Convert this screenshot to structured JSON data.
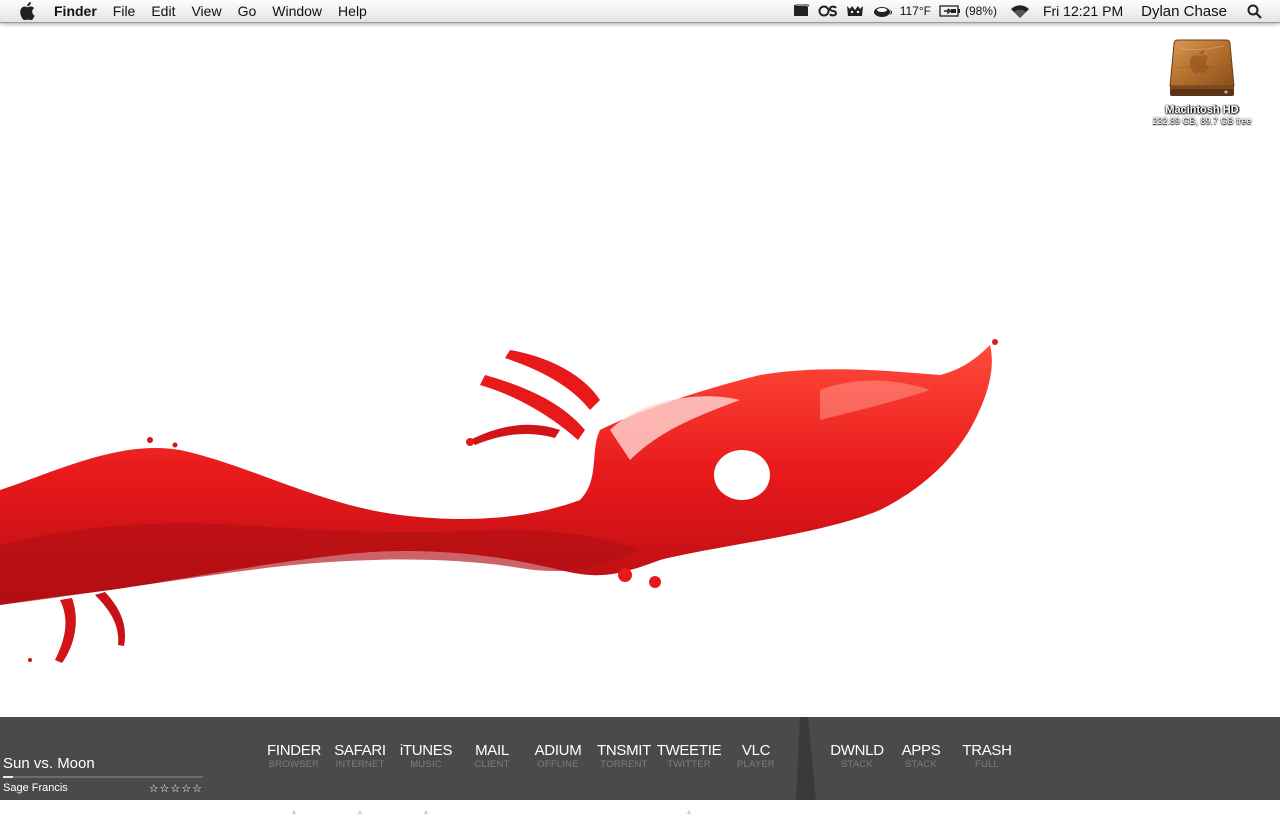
{
  "menubar": {
    "apple_icon": "apple-logo-icon",
    "app_name": "Finder",
    "items": [
      "File",
      "Edit",
      "View",
      "Go",
      "Window",
      "Help"
    ],
    "status": {
      "temperature": "117°F",
      "battery_percent": "(98%)",
      "clock": "Fri 12:21 PM",
      "user": "Dylan Chase"
    }
  },
  "desktop": {
    "drive_name": "Macintosh HD",
    "drive_info": "232.89 GB, 89.7 GB free"
  },
  "dock": {
    "now_playing": {
      "song": "Sun vs. Moon",
      "artist": "Sage Francis",
      "rating_stars": "☆☆☆☆☆",
      "progress": 0.05
    },
    "apps": [
      {
        "title": "FINDER",
        "sub": "BROWSER",
        "running": true
      },
      {
        "title": "SAFARI",
        "sub": "INTERNET",
        "running": true
      },
      {
        "title": "iTUNES",
        "sub": "MUSIC",
        "running": true
      },
      {
        "title": "MAIL",
        "sub": "CLIENT",
        "running": false
      },
      {
        "title": "ADIUM",
        "sub": "OFFLINE",
        "running": false
      },
      {
        "title": "TNSMIT",
        "sub": "TORRENT",
        "running": false
      },
      {
        "title": "TWEETIE",
        "sub": "TWITTER",
        "running": true
      },
      {
        "title": "VLC",
        "sub": "PLAYER",
        "running": false
      }
    ],
    "stacks": [
      {
        "title": "DWNLD",
        "sub": "STACK"
      },
      {
        "title": "APPS",
        "sub": "STACK"
      },
      {
        "title": "TRASH",
        "sub": "FULL"
      }
    ],
    "running_indicator": "▲"
  },
  "colors": {
    "dock_bg": "#4a4a4a",
    "dock_sub": "#7d7d7d",
    "splash_red": "#e8191b"
  }
}
